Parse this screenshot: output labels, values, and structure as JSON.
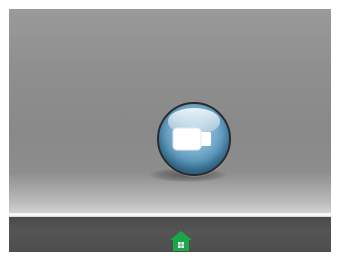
{
  "icons": {
    "connect": "plug-icon",
    "home": "home-icon"
  },
  "colors": {
    "connect_button": "#5b9bc4",
    "home_icon": "#19a847",
    "bottom_bar": "#4f4f4f",
    "background": "#8d8d8d"
  }
}
